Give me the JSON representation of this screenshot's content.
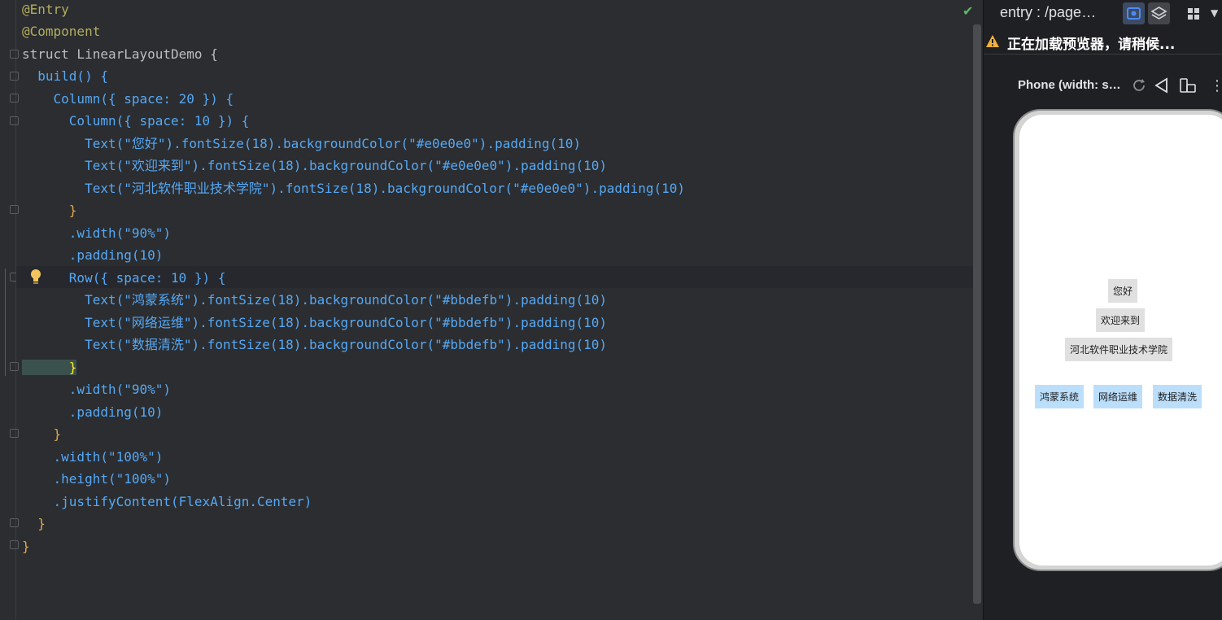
{
  "editor": {
    "lines": [
      "@Entry",
      "@Component",
      "struct LinearLayoutDemo {",
      "  build() {",
      "    Column({ space: 20 }) {",
      "      Column({ space: 10 }) {",
      "        Text(\"您好\").fontSize(18).backgroundColor(\"#e0e0e0\").padding(10)",
      "        Text(\"欢迎来到\").fontSize(18).backgroundColor(\"#e0e0e0\").padding(10)",
      "        Text(\"河北软件职业技术学院\").fontSize(18).backgroundColor(\"#e0e0e0\").padding(10)",
      "      }",
      "      .width(\"90%\")",
      "      .padding(10)",
      "      Row({ space: 10 }) {",
      "        Text(\"鸿蒙系统\").fontSize(18).backgroundColor(\"#bbdefb\").padding(10)",
      "        Text(\"网络运维\").fontSize(18).backgroundColor(\"#bbdefb\").padding(10)",
      "        Text(\"数据清洗\").fontSize(18).backgroundColor(\"#bbdefb\").padding(10)",
      "      }",
      "      .width(\"90%\")",
      "      .padding(10)",
      "    }",
      "    .width(\"100%\")",
      "    .height(\"100%\")",
      "    .justifyContent(FlexAlign.Center)",
      "  }",
      "}"
    ]
  },
  "previewer": {
    "title": "entry : /page…",
    "warning": "正在加载预览器，请稍候...",
    "device_label": "Phone (width: s…",
    "icons": [
      "eye-icon",
      "layers-icon",
      "grid-icon",
      "chevron-down-icon",
      "warning-icon",
      "rotate-icon",
      "back-icon",
      "fold-icon",
      "kebab-icon"
    ],
    "column_texts": [
      "您好",
      "欢迎来到",
      "河北软件职业技术学院"
    ],
    "row_texts": [
      "鸿蒙系统",
      "网络运维",
      "数据清洗"
    ],
    "colors": {
      "grey": "#e0e0e0",
      "blue": "#bbdefb"
    }
  }
}
